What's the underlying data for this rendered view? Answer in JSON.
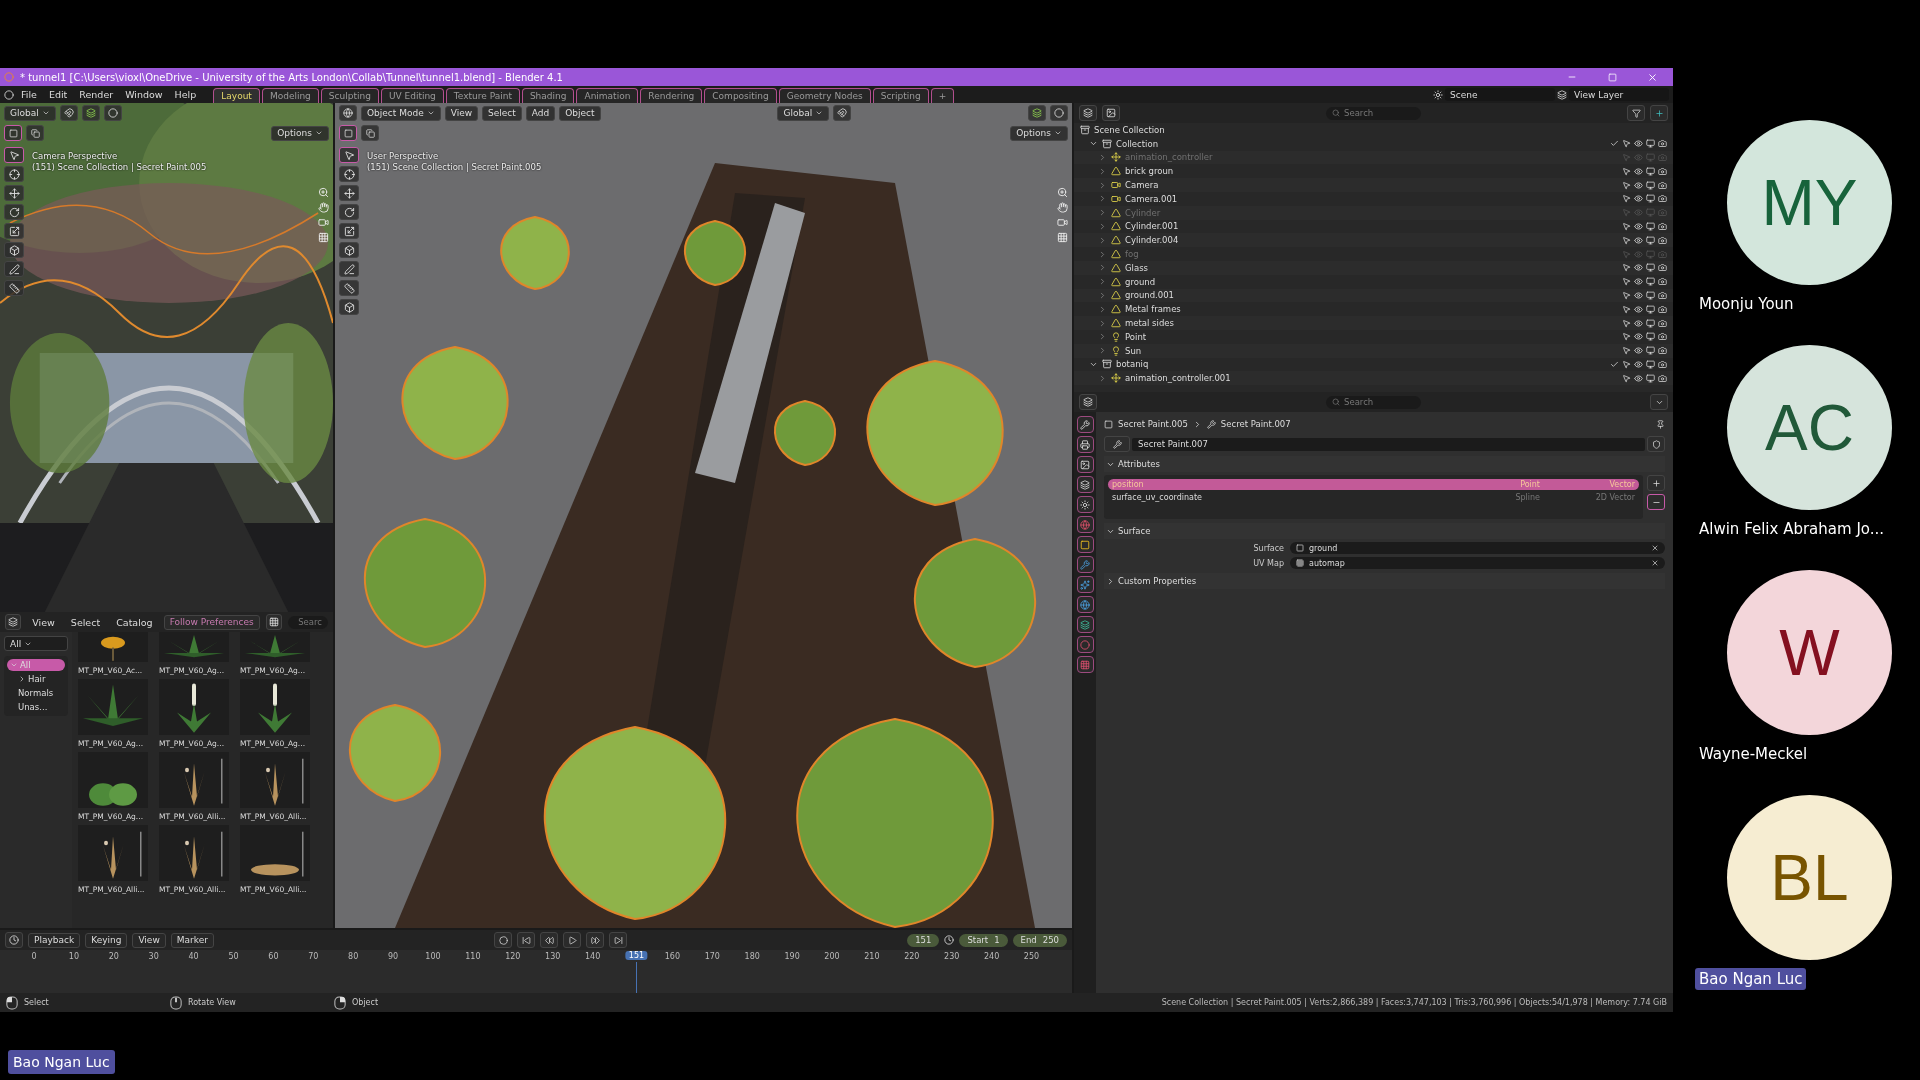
{
  "window": {
    "title": "* tunnel1 [C:\\Users\\vioxl\\OneDrive - University of the Arts London\\Collab\\Tunnel\\tunnel1.blend] - Blender 4.1"
  },
  "menu": [
    "File",
    "Edit",
    "Render",
    "Window",
    "Help"
  ],
  "workspaces": [
    {
      "label": "Layout",
      "selected": true
    },
    {
      "label": "Modeling",
      "selected": false
    },
    {
      "label": "Sculpting",
      "selected": false
    },
    {
      "label": "UV Editing",
      "selected": false
    },
    {
      "label": "Texture Paint",
      "selected": false
    },
    {
      "label": "Shading",
      "selected": false
    },
    {
      "label": "Animation",
      "selected": false
    },
    {
      "label": "Rendering",
      "selected": false
    },
    {
      "label": "Compositing",
      "selected": false
    },
    {
      "label": "Geometry Nodes",
      "selected": false
    },
    {
      "label": "Scripting",
      "selected": false
    }
  ],
  "add_workspace": "+",
  "scene": "Scene",
  "view_layer": "View Layer",
  "camera_view": {
    "transform": "Global",
    "options": "Options",
    "overlay_title": "Camera Perspective",
    "overlay_subtitle": "(151) Scene Collection | Secret Paint.005"
  },
  "main_view": {
    "mode": "Object Mode",
    "menus": [
      "View",
      "Select",
      "Add",
      "Object"
    ],
    "transform": "Global",
    "options": "Options",
    "overlay_title": "User Perspective",
    "overlay_subtitle": "(151) Scene Collection | Secret Paint.005"
  },
  "asset_browser": {
    "menus": [
      "View",
      "Select",
      "Catalog"
    ],
    "import_method": "Follow Preferences",
    "search_placeholder": "Searc",
    "library": "All",
    "catalogs": [
      {
        "label": "All",
        "selected": true,
        "expanded": true,
        "children": [
          {
            "label": "Hair",
            "selected": false,
            "expanded": false
          },
          {
            "label": "Normals",
            "selected": false
          },
          {
            "label": "Unas...",
            "selected": false
          }
        ]
      }
    ],
    "assets": [
      {
        "name": "MT_PM_V60_Ac...",
        "kind": "flower"
      },
      {
        "name": "MT_PM_V60_Ag...",
        "kind": "agave"
      },
      {
        "name": "MT_PM_V60_Ag...",
        "kind": "agave"
      },
      {
        "name": "MT_PM_V60_Ag...",
        "kind": "agave"
      },
      {
        "name": "MT_PM_V60_Ag...",
        "kind": "spike"
      },
      {
        "name": "MT_PM_V60_Ag...",
        "kind": "spike"
      },
      {
        "name": "MT_PM_V60_Ag...",
        "kind": "clump"
      },
      {
        "name": "MT_PM_V60_Alli...",
        "kind": "grass"
      },
      {
        "name": "MT_PM_V60_Alli...",
        "kind": "grass"
      },
      {
        "name": "MT_PM_V60_Alli...",
        "kind": "grass"
      },
      {
        "name": "MT_PM_V60_Alli...",
        "kind": "grass"
      },
      {
        "name": "MT_PM_V60_Alli...",
        "kind": "flat"
      }
    ]
  },
  "outliner": {
    "search_placeholder": "Search",
    "root": "Scene Collection",
    "collections": [
      {
        "name": "Collection",
        "expanded": true,
        "children": [
          {
            "name": "animation_controller",
            "kind": "empty",
            "disabled": true,
            "expanded": false
          },
          {
            "name": "brick groun",
            "kind": "mesh",
            "disabled": false,
            "expanded": false
          },
          {
            "name": "Camera",
            "kind": "camera",
            "disabled": false,
            "expanded": false
          },
          {
            "name": "Camera.001",
            "kind": "camera",
            "disabled": false,
            "expanded": false
          },
          {
            "name": "Cylinder",
            "kind": "mesh",
            "disabled": true,
            "expanded": false
          },
          {
            "name": "Cylinder.001",
            "kind": "mesh",
            "disabled": false,
            "expanded": false
          },
          {
            "name": "Cylinder.004",
            "kind": "mesh",
            "disabled": false,
            "expanded": false
          },
          {
            "name": "fog",
            "kind": "mesh",
            "disabled": true,
            "expanded": false
          },
          {
            "name": "Glass",
            "kind": "mesh",
            "disabled": false,
            "expanded": false
          },
          {
            "name": "ground",
            "kind": "mesh",
            "disabled": false,
            "expanded": false
          },
          {
            "name": "ground.001",
            "kind": "mesh",
            "disabled": false,
            "expanded": false
          },
          {
            "name": "Metal frames",
            "kind": "mesh",
            "disabled": false,
            "expanded": false
          },
          {
            "name": "metal sides",
            "kind": "mesh",
            "disabled": false,
            "expanded": false
          },
          {
            "name": "Point",
            "kind": "light",
            "disabled": false,
            "expanded": false
          },
          {
            "name": "Sun",
            "kind": "light",
            "disabled": false,
            "expanded": false
          }
        ]
      },
      {
        "name": "botaniq",
        "expanded": true,
        "children": [
          {
            "name": "animation_controller.001",
            "kind": "empty",
            "disabled": false,
            "expanded": false
          }
        ]
      }
    ]
  },
  "properties": {
    "search_placeholder": "Search",
    "breadcrumb": [
      "Secret Paint.005",
      "Secret Paint.007"
    ],
    "data_name": "Secret Paint.007",
    "panels": [
      {
        "title": "Attributes",
        "kind": "attributes",
        "expanded": true,
        "rows": [
          {
            "name": "position",
            "domain": "Point",
            "type": "Vector",
            "selected": true
          },
          {
            "name": "surface_uv_coordinate",
            "domain": "Spline",
            "type": "2D Vector",
            "selected": false
          }
        ]
      },
      {
        "title": "Surface",
        "kind": "fields",
        "expanded": true,
        "fields": [
          {
            "label": "Surface",
            "value": "ground",
            "kind": "object"
          },
          {
            "label": "UV Map",
            "value": "automap",
            "kind": "uv"
          }
        ]
      },
      {
        "title": "Custom Properties",
        "expanded": false
      }
    ]
  },
  "timeline": {
    "menus": [
      "Playback",
      "Keying",
      "View",
      "Marker"
    ],
    "current_frame": "151",
    "start_label": "Start",
    "start": "1",
    "end_label": "End",
    "end": "250",
    "playhead": "151",
    "ruler": [
      "0",
      "10",
      "20",
      "30",
      "40",
      "50",
      "60",
      "70",
      "80",
      "90",
      "100",
      "110",
      "120",
      "130",
      "140",
      "160",
      "170",
      "180",
      "190",
      "200",
      "210",
      "220",
      "230",
      "240",
      "250"
    ]
  },
  "status_bar": {
    "hints": [
      {
        "label": "Select",
        "kind": "left"
      },
      {
        "label": "Rotate View",
        "kind": "middle"
      },
      {
        "label": "Object",
        "kind": "right"
      }
    ],
    "stats": "Scene Collection | Secret Paint.005 | Verts:2,866,389 | Faces:3,747,103 | Tris:3,760,996 | Objects:54/1,978 | Memory: 7.74 GiB"
  },
  "participants": [
    {
      "initials": "MY",
      "name": "Moonju Youn",
      "color": "#d3e6dc",
      "highlighted": false
    },
    {
      "initials": "AC",
      "name": "Alwin Felix Abraham Jo...",
      "color": "#d6e4dc",
      "highlighted": false
    },
    {
      "initials": "W",
      "name": "Wayne-Meckel",
      "color": "#f3d6da",
      "highlighted": false
    },
    {
      "initials": "BL",
      "name": "Bao Ngan Luc",
      "color": "#f6edd2",
      "highlighted": true
    }
  ],
  "self_view": {
    "name": "Bao Ngan Luc"
  }
}
